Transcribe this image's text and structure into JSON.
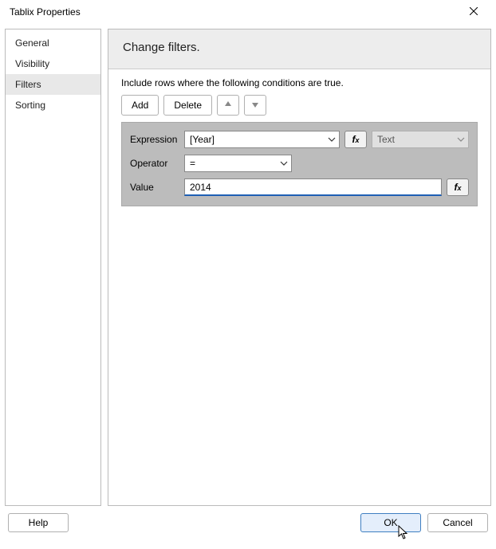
{
  "window": {
    "title": "Tablix Properties"
  },
  "sidebar": {
    "items": [
      {
        "label": "General"
      },
      {
        "label": "Visibility"
      },
      {
        "label": "Filters"
      },
      {
        "label": "Sorting"
      }
    ],
    "selected_index": 2
  },
  "pane": {
    "title": "Change filters.",
    "instruction": "Include rows where the following conditions are true.",
    "add_label": "Add",
    "delete_label": "Delete",
    "filter": {
      "expression_label": "Expression",
      "expression_value": "[Year]",
      "type_value": "Text",
      "operator_label": "Operator",
      "operator_value": "=",
      "value_label": "Value",
      "value_value": "2014"
    }
  },
  "footer": {
    "help_label": "Help",
    "ok_label": "OK",
    "cancel_label": "Cancel"
  }
}
